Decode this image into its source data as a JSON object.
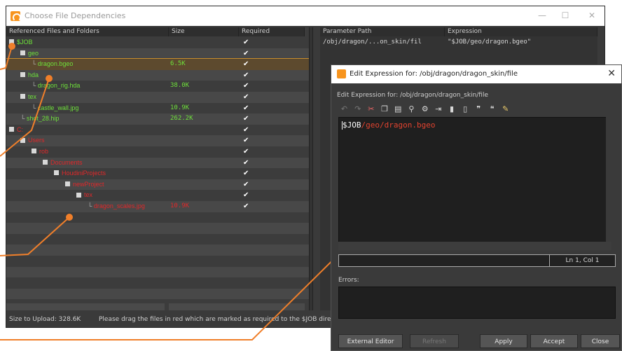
{
  "main_window": {
    "title": "Choose File Dependencies",
    "minimize": "—",
    "maximize": "☐",
    "close": "✕"
  },
  "tree": {
    "headers": {
      "name": "Referenced Files and Folders",
      "size": "Size",
      "required": "Required"
    },
    "rows": [
      {
        "name": "$JOB",
        "size": "",
        "required": "✔",
        "color": "green",
        "depth": 0,
        "expander": true
      },
      {
        "name": "geo",
        "size": "",
        "required": "✔",
        "color": "green",
        "depth": 1,
        "expander": true
      },
      {
        "name": "dragon.bgeo",
        "size": "6.5K",
        "required": "✔",
        "color": "green",
        "depth": 2,
        "expander": false,
        "selected": true
      },
      {
        "name": "hda",
        "size": "",
        "required": "✔",
        "color": "green",
        "depth": 1,
        "expander": true
      },
      {
        "name": "dragon_rig.hda",
        "size": "38.0K",
        "required": "✔",
        "color": "green",
        "depth": 2,
        "expander": false
      },
      {
        "name": "tex",
        "size": "",
        "required": "✔",
        "color": "green",
        "depth": 1,
        "expander": true
      },
      {
        "name": "castle_wall.jpg",
        "size": "10.9K",
        "required": "✔",
        "color": "green",
        "depth": 2,
        "expander": false
      },
      {
        "name": "shot_28.hip",
        "size": "262.2K",
        "required": "✔",
        "color": "green",
        "depth": 1,
        "expander": false
      },
      {
        "name": "C:",
        "size": "",
        "required": "✔",
        "color": "red",
        "depth": 0,
        "expander": true
      },
      {
        "name": "Users",
        "size": "",
        "required": "✔",
        "color": "red",
        "depth": 1,
        "expander": true
      },
      {
        "name": "rob",
        "size": "",
        "required": "✔",
        "color": "red",
        "depth": 2,
        "expander": true
      },
      {
        "name": "Documents",
        "size": "",
        "required": "✔",
        "color": "red",
        "depth": 3,
        "expander": true
      },
      {
        "name": "HoudiniProjects",
        "size": "",
        "required": "✔",
        "color": "red",
        "depth": 4,
        "expander": true
      },
      {
        "name": "newProject",
        "size": "",
        "required": "✔",
        "color": "red",
        "depth": 5,
        "expander": true
      },
      {
        "name": "tex",
        "size": "",
        "required": "✔",
        "color": "red",
        "depth": 6,
        "expander": true
      },
      {
        "name": "dragon_scales.jpg",
        "size": "10.9K",
        "required": "✔",
        "color": "red",
        "depth": 7,
        "expander": false
      }
    ]
  },
  "params": {
    "headers": {
      "path": "Parameter Path",
      "expression": "Expression"
    },
    "path": "/obj/dragon/...on_skin/fil",
    "expression": "\"$JOB/geo/dragon.bgeo\""
  },
  "status": {
    "size_to_upload": "Size to Upload: 328.6K",
    "message": "Please drag the files in red which are marked as required to the $JOB direc"
  },
  "dialog": {
    "title": "Edit Expression for: /obj/dragon/dragon_skin/file",
    "label": "Edit Expression for: /obj/dragon/dragon_skin/file",
    "close": "✕",
    "expr_var": "$JOB",
    "expr_path": "/geo/dragon.bgeo",
    "cursor_pos": "Ln 1, Col 1",
    "errors_label": "Errors:",
    "buttons": {
      "external_editor": "External Editor",
      "refresh": "Refresh",
      "apply": "Apply",
      "accept": "Accept",
      "close": "Close"
    }
  },
  "colors": {
    "ok": "#6ee03a",
    "missing": "#e0282a",
    "accent": "#f7941d",
    "callout": "#f07f2a"
  }
}
